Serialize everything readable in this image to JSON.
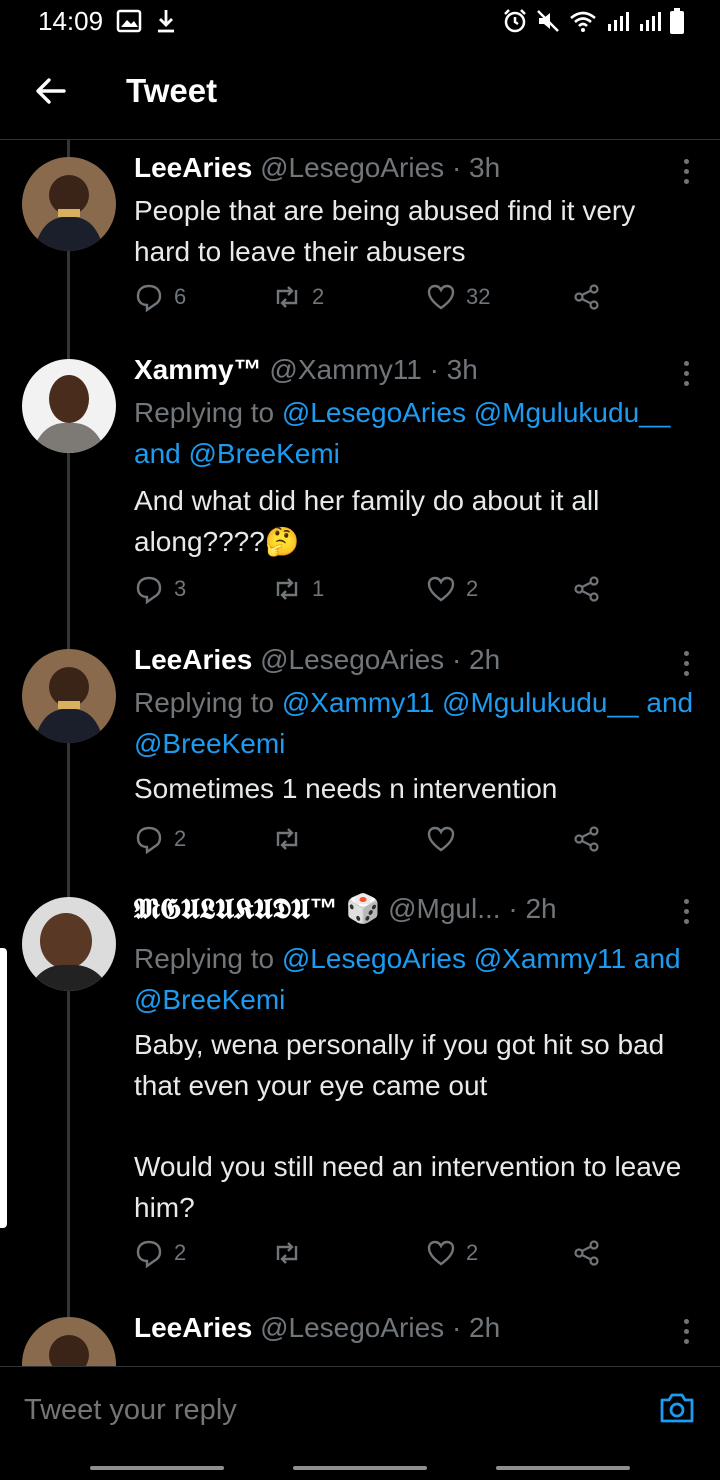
{
  "status_bar": {
    "time": "14:09"
  },
  "header": {
    "title": "Tweet"
  },
  "tweets": [
    {
      "name": "LeeAries",
      "handle": "@LesegoAries",
      "time": "· 3h",
      "text": "People that are being abused find it very hard to leave their abusers",
      "replies": "6",
      "retweets": "2",
      "likes": "32"
    },
    {
      "name": "Xammy™",
      "handle": "@Xammy11",
      "time": "· 3h",
      "replying_label": "Replying to",
      "mention1": "@LesegoAries",
      "mention2": "@Mgulukudu__",
      "and_label": "and",
      "mention3": "@BreeKemi",
      "text": "And what did her family do about it all along????🤔",
      "replies": "3",
      "retweets": "1",
      "likes": "2"
    },
    {
      "name": "LeeAries",
      "handle": "@LesegoAries",
      "time": "· 2h",
      "replying_label": "Replying to",
      "mention1": "@Xammy11",
      "mention2": "@Mgulukudu__",
      "and_label": "and",
      "mention3": "@BreeKemi",
      "text": "Sometimes 1 needs n intervention",
      "replies": "2",
      "retweets": "",
      "likes": ""
    },
    {
      "name": "𝕸𝕲𝖀𝕷𝖀𝕶𝖀𝕯𝖀™ 🎲",
      "handle": "@Mgul...",
      "time": "· 2h",
      "replying_label": "Replying to",
      "mention1": "@LesegoAries",
      "mention2": "@Xammy11",
      "and_label": "and",
      "mention3": "@BreeKemi",
      "text_p1": "Baby, wena personally if you got hit so bad that even your eye came out",
      "text_p2": "Would you still need an intervention to leave him?",
      "replies": "2",
      "retweets": "",
      "likes": "2"
    },
    {
      "name": "LeeAries",
      "handle": "@LesegoAries",
      "time": "· 2h"
    }
  ],
  "compose": {
    "placeholder": "Tweet your reply"
  },
  "colors": {
    "accent": "#1d9bf0",
    "muted": "#71767b",
    "background": "#000000"
  }
}
